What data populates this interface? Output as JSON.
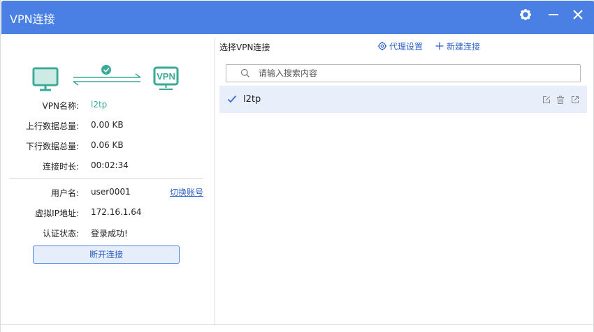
{
  "window": {
    "title": "VPN连接"
  },
  "status": {
    "vpn_name_label": "VPN名称:",
    "vpn_name": "l2tp",
    "upload_label": "上行数据总量:",
    "upload": "0.00 KB",
    "download_label": "下行数据总量:",
    "download": "0.06 KB",
    "duration_label": "连接时长:",
    "duration": "00:02:34",
    "username_label": "用户名:",
    "username": "user0001",
    "switch_account": "切换账号",
    "virtual_ip_label": "虚拟IP地址:",
    "virtual_ip": "172.16.1.64",
    "auth_label": "认证状态:",
    "auth": "登录成功!",
    "disconnect": "断开连接"
  },
  "connections": {
    "title": "选择VPN连接",
    "proxy_settings": "代理设置",
    "new_connection": "新建连接",
    "search_placeholder": "请输入搜索内容",
    "items": [
      {
        "name": "l2tp",
        "selected": true
      }
    ]
  },
  "colors": {
    "accent": "#4a7fe3",
    "green": "#3aaa96",
    "link": "#2f63c7"
  }
}
